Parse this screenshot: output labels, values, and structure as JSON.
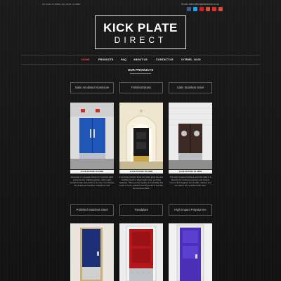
{
  "header": {
    "phone": "Tel: 0161 7xx 5555  |  Fax: 0161 7xx 5556",
    "email": "Email: sales@kickplatedirect.co.uk",
    "social_icons": [
      {
        "name": "facebook-icon",
        "color": "#3b5998"
      },
      {
        "name": "twitter-icon",
        "color": "#1da1f2"
      },
      {
        "name": "pinterest-icon",
        "color": "#cb2027"
      },
      {
        "name": "google-plus-icon",
        "color": "#dd4b39"
      },
      {
        "name": "youtube-icon",
        "color": "#e52d27"
      },
      {
        "name": "email-icon",
        "color": "#d94a3b"
      }
    ]
  },
  "logo": {
    "line1": "KICK PLATE",
    "line2": "DIRECT"
  },
  "nav": {
    "items": [
      "HOME",
      "PRODUCTS",
      "FAQ",
      "ABOUT US",
      "CONTACT US"
    ],
    "active": "HOME",
    "basket": "0 ITEMS - £0.00"
  },
  "section_title": "OUR PRODUCTS",
  "products": [
    {
      "label": "Satin Anodised Aluminium",
      "button": "CLICK PICTURE TO OPEN",
      "description": "Aluminium is a popular choice for most kick plate environments. Highly protective, with a satin anodised finish, this model is not only cost effective but durable and weather resistant as well."
    },
    {
      "label": "Polished Brass",
      "button": "CLICK PICTURE TO OPEN",
      "description": "A stunning polished brass kick plate gives the door finishing touch to what it adds style, yet brass hardware. With a perfect quality and durability, this model is mirror polished and lacquered to maintain the luminous shine."
    },
    {
      "label": "Satin Stainless Steel",
      "button": "CLICK PICTURE TO OPEN",
      "description": "This satin brushed stainless steel kick plate is a favourite for business premises and modern homes. Both hygienic and durable, efficient and can reduce any scratched with ease."
    },
    {
      "label": "Polished Stainless Steel"
    },
    {
      "label": "Treadplate"
    },
    {
      "label": "High Impact Polystyrene"
    }
  ],
  "colors": {
    "accent": "#e8483b",
    "background": "#161616",
    "text": "#dddddd"
  }
}
